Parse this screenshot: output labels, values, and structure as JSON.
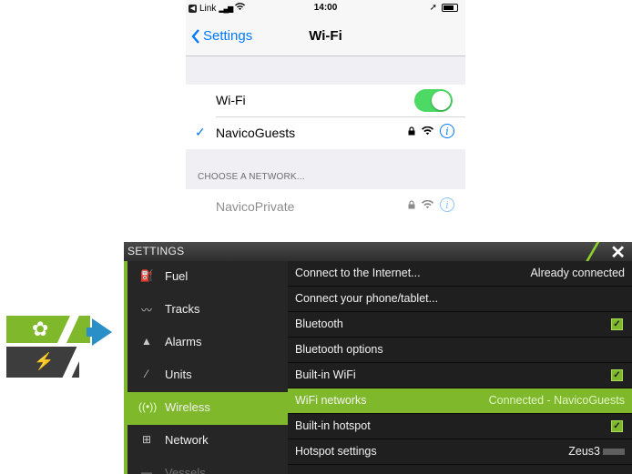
{
  "phone": {
    "status": {
      "back_app": "Link",
      "time": "14:00"
    },
    "nav": {
      "back_label": "Settings",
      "title": "Wi-Fi"
    },
    "wifi_row_label": "Wi-Fi",
    "wifi_enabled": true,
    "connected_network": "NavicoGuests",
    "section_header": "CHOOSE A NETWORK...",
    "other_network": "NavicoPrivate",
    "accent": "#007aff",
    "toggle_color": "#4cd964"
  },
  "zeus": {
    "title": "SETTINGS",
    "sidebar": {
      "items": [
        {
          "label": "Fuel",
          "icon": "fuel-icon"
        },
        {
          "label": "Tracks",
          "icon": "tracks-icon"
        },
        {
          "label": "Alarms",
          "icon": "alarm-bell-icon"
        },
        {
          "label": "Units",
          "icon": "units-ruler-icon"
        },
        {
          "label": "Wireless",
          "icon": "wireless-icon"
        },
        {
          "label": "Network",
          "icon": "network-icon"
        },
        {
          "label": "Vessels",
          "icon": "vessels-icon"
        }
      ],
      "selected": "Wireless"
    },
    "rows": [
      {
        "label": "Connect to the Internet...",
        "value": "Already connected"
      },
      {
        "label": "Connect your phone/tablet...",
        "value": ""
      },
      {
        "label": "Bluetooth",
        "checked": true
      },
      {
        "label": "Bluetooth options",
        "value": ""
      },
      {
        "label": "Built-in WiFi",
        "checked": true
      },
      {
        "label": "WiFi networks",
        "value": "Connected - NavicoGuests"
      },
      {
        "label": "Built-in hotspot",
        "checked": true
      },
      {
        "label": "Hotspot settings",
        "value": "Zeus3"
      }
    ],
    "accent": "#7fb82a"
  }
}
